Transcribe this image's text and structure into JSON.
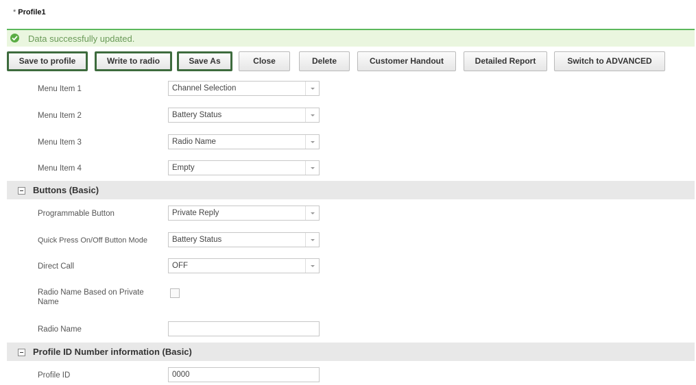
{
  "window": {
    "title": "Profile1",
    "modified_marker": "*"
  },
  "status": {
    "message": "Data successfully updated."
  },
  "toolbar": {
    "buttons": [
      {
        "label": "Save to profile"
      },
      {
        "label": "Write to radio"
      },
      {
        "label": "Save As"
      },
      {
        "label": "Close"
      },
      {
        "label": "Delete"
      },
      {
        "label": "Customer Handout"
      },
      {
        "label": "Detailed Report"
      },
      {
        "label": "Switch to ADVANCED"
      }
    ]
  },
  "menu": {
    "items": [
      {
        "label": "Menu Item 1",
        "value": "Channel Selection"
      },
      {
        "label": "Menu Item 2",
        "value": "Battery Status"
      },
      {
        "label": "Menu Item 3",
        "value": "Radio Name"
      },
      {
        "label": "Menu Item 4",
        "value": "Empty"
      }
    ]
  },
  "buttons_section": {
    "title": "Buttons (Basic)",
    "programmable_button": {
      "label": "Programmable Button",
      "value": "Private Reply"
    },
    "quick_press": {
      "label": "Quick Press On/Off Button Mode",
      "value": "Battery Status"
    },
    "direct_call": {
      "label": "Direct Call",
      "value": "OFF"
    },
    "radio_name_based": {
      "label": "Radio Name Based on Private Name",
      "checked": false
    },
    "radio_name": {
      "label": "Radio Name",
      "value": ""
    }
  },
  "profile_section": {
    "title": "Profile ID Number information (Basic)",
    "profile_id": {
      "label": "Profile ID",
      "value": "0000"
    }
  },
  "colors": {
    "accent_green": "#5cb85c",
    "status_bg": "#eaf6df",
    "section_bg": "#e8e8e8"
  }
}
